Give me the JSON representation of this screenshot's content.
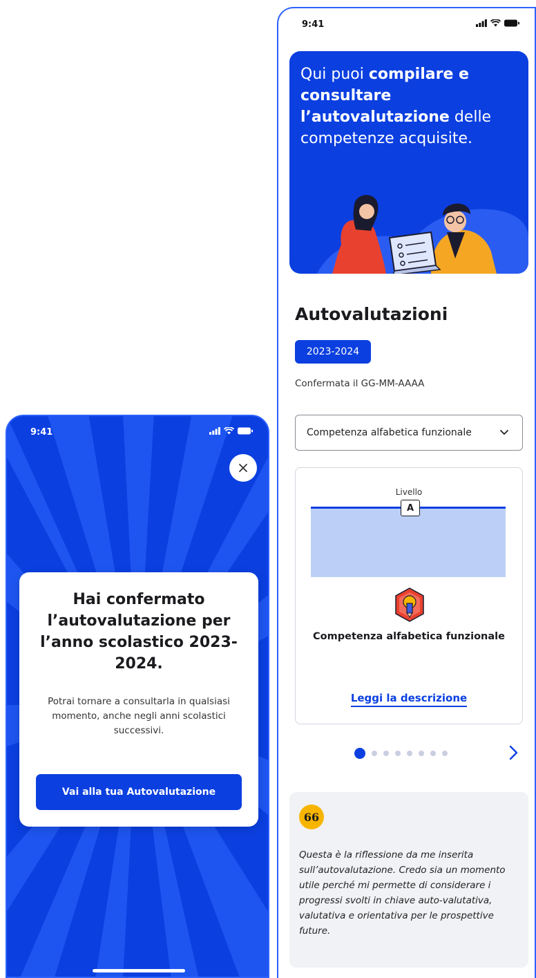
{
  "left_screen": {
    "status_time": "9:41",
    "modal": {
      "title": "Hai confermato l’autovalutazione per l’anno scolastico 2023-2024.",
      "text": "Potrai tornare a consultarla in qualsiasi momento, anche negli anni scolastici successivi.",
      "button_label": "Vai alla tua Autovalutazione"
    },
    "close_icon": "close-icon"
  },
  "right_screen": {
    "status_time": "9:41",
    "hero": {
      "text_before": "Qui puoi ",
      "text_bold_1": "compilare e consultare l’autovalutazione",
      "text_after": " delle competenze acquisite."
    },
    "section_title": "Autovalutazioni",
    "year_chip": "2023-2024",
    "confirmed_text": "Confermata il GG-MM-AAAA",
    "select": {
      "value": "Competenza alfabetica funzionale"
    },
    "card": {
      "level_label": "Livello",
      "level_value": "A",
      "competence_name": "Competenza alfabetica funzionale",
      "link_label": "Leggi la descrizione"
    },
    "pagination": {
      "total": 8,
      "active": 1
    },
    "quote": {
      "icon_text": "66",
      "text": "Questa è la riflessione da me inserita sull’autovalutazione. Credo sia un momento utile perché mi permette di considerare i progressi svolti in chiave auto-valutativa, valutativa e orientativa per le prospettive future."
    }
  },
  "colors": {
    "primary": "#0b3fe0",
    "level_band": "#bcd0f7",
    "quote_icon": "#f7b500"
  }
}
